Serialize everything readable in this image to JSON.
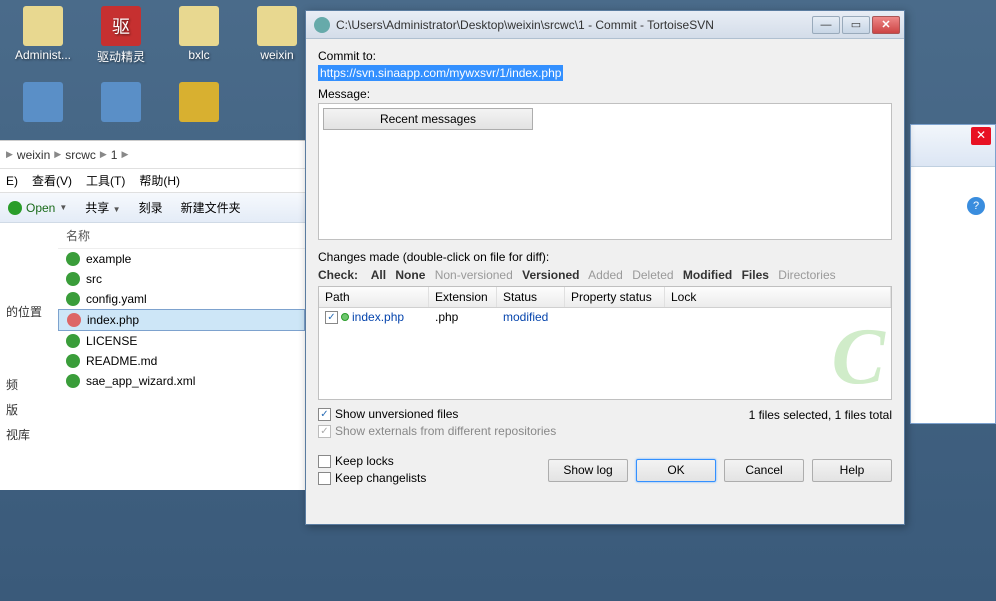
{
  "desktop": {
    "icons": [
      {
        "label": "Administ...",
        "type": "folder"
      },
      {
        "label": "驱动精灵",
        "type": "red",
        "glyph": "驱"
      },
      {
        "label": "bxlc",
        "type": "folder"
      },
      {
        "label": "weixin",
        "type": "folder"
      }
    ]
  },
  "explorer": {
    "crumbs": [
      "weixin",
      "srcwc",
      "1"
    ],
    "menu": [
      "E)",
      "查看(V)",
      "工具(T)",
      "帮助(H)"
    ],
    "toolbar": {
      "open": "Open",
      "share": "共享",
      "burn": "刻录",
      "newfolder": "新建文件夹"
    },
    "sidebar": [
      "的位置",
      "频",
      "版",
      "视库"
    ],
    "colHeader": "名称",
    "files": [
      {
        "name": "example"
      },
      {
        "name": "src"
      },
      {
        "name": "config.yaml"
      },
      {
        "name": "index.php",
        "sel": true
      },
      {
        "name": "LICENSE"
      },
      {
        "name": "README.md"
      },
      {
        "name": "sae_app_wizard.xml"
      }
    ]
  },
  "dialog": {
    "title": "C:\\Users\\Administrator\\Desktop\\weixin\\srcwc\\1 - Commit - TortoiseSVN",
    "commitToLabel": "Commit to:",
    "url": "https://svn.sinaapp.com/mywxsvr/1/index.php",
    "messageLabel": "Message:",
    "recentButton": "Recent messages",
    "changesLabel": "Changes made (double-click on file for diff):",
    "checkLabel": "Check:",
    "filters": {
      "all": "All",
      "none": "None",
      "nonv": "Non-versioned",
      "versioned": "Versioned",
      "added": "Added",
      "deleted": "Deleted",
      "modified": "Modified",
      "files": "Files",
      "dirs": "Directories"
    },
    "gridHeaders": {
      "path": "Path",
      "ext": "Extension",
      "status": "Status",
      "prop": "Property status",
      "lock": "Lock"
    },
    "gridRow": {
      "path": "index.php",
      "ext": ".php",
      "status": "modified"
    },
    "showUnversioned": "Show unversioned files",
    "showExternals": "Show externals from different repositories",
    "summary": "1 files selected, 1 files total",
    "keepLocks": "Keep locks",
    "keepChangelists": "Keep changelists",
    "buttons": {
      "showlog": "Show log",
      "ok": "OK",
      "cancel": "Cancel",
      "help": "Help"
    }
  }
}
